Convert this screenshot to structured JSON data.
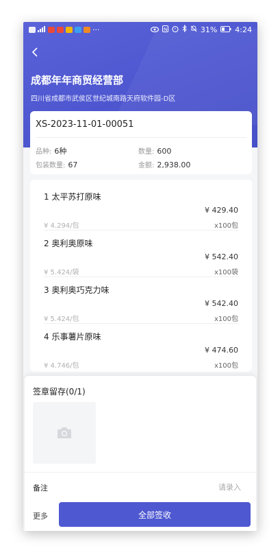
{
  "status_bar": {
    "left_icons": [
      "sim-icon",
      "signal-icon",
      "app-icon",
      "app-icon",
      "app-icon",
      "app-icon",
      "app-icon"
    ],
    "left_more": "···",
    "battery_text": "31%",
    "time": "4:24"
  },
  "header": {
    "company": "成都年年商贸经营部",
    "address": "四川省成都市武侯区世纪城南路天府软件园-D区"
  },
  "summary": {
    "order_no": "XS-2023-11-01-00051",
    "variety_label": "品种:",
    "variety_value": "6种",
    "quantity_label": "数量:",
    "quantity_value": "600",
    "pack_qty_label": "包装数量:",
    "pack_qty_value": "67",
    "amount_label": "金额:",
    "amount_value": "2,938.00"
  },
  "items": [
    {
      "name": "1  太平苏打原味",
      "total": "¥ 429.40",
      "unit_price": "¥ 4.294/包",
      "qty": "x100包"
    },
    {
      "name": "2  奥利奥原味",
      "total": "¥ 542.40",
      "unit_price": "¥ 5.424/袋",
      "qty": "x100袋"
    },
    {
      "name": "3  奥利奥巧克力味",
      "total": "¥ 542.40",
      "unit_price": "¥ 5.424/包",
      "qty": "x100包"
    },
    {
      "name": "4  乐事薯片原味",
      "total": "¥ 474.60",
      "unit_price": "¥ 4.746/包",
      "qty": "x100包"
    }
  ],
  "seal": {
    "title": "签章留存(0/1)"
  },
  "remark": {
    "label": "备注",
    "placeholder": "请录入"
  },
  "footer": {
    "more": "更多",
    "sign_all": "全部签收"
  },
  "colors": {
    "primary": "#4e58d1",
    "header_bg": "#5a63d8"
  }
}
